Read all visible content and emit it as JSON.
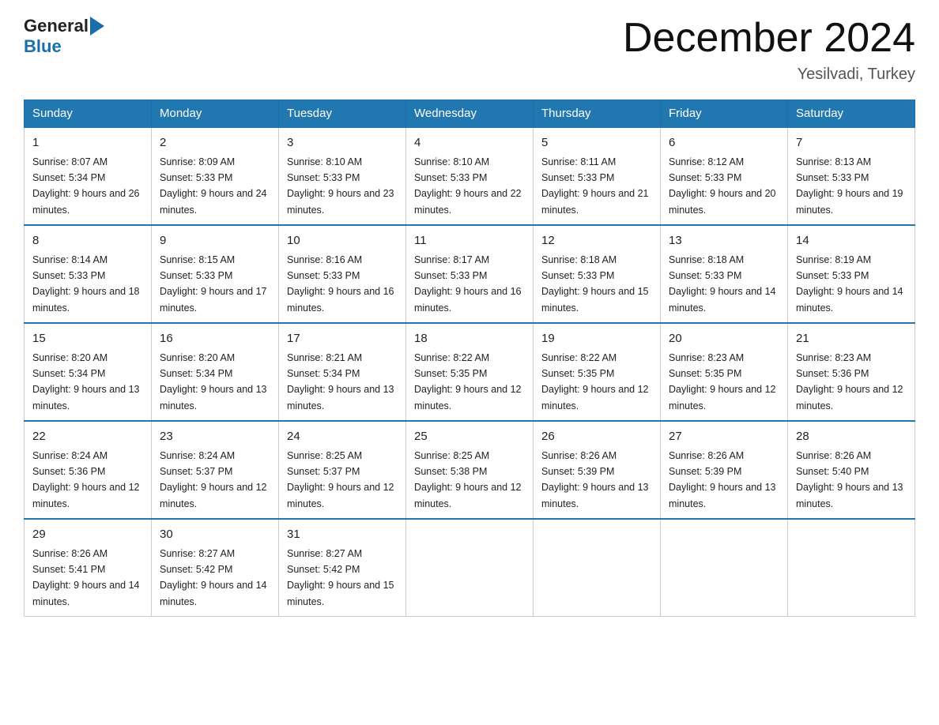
{
  "logo": {
    "general": "General",
    "blue": "Blue"
  },
  "title": "December 2024",
  "location": "Yesilvadi, Turkey",
  "days_of_week": [
    "Sunday",
    "Monday",
    "Tuesday",
    "Wednesday",
    "Thursday",
    "Friday",
    "Saturday"
  ],
  "weeks": [
    [
      {
        "num": "1",
        "sunrise": "8:07 AM",
        "sunset": "5:34 PM",
        "daylight": "9 hours and 26 minutes."
      },
      {
        "num": "2",
        "sunrise": "8:09 AM",
        "sunset": "5:33 PM",
        "daylight": "9 hours and 24 minutes."
      },
      {
        "num": "3",
        "sunrise": "8:10 AM",
        "sunset": "5:33 PM",
        "daylight": "9 hours and 23 minutes."
      },
      {
        "num": "4",
        "sunrise": "8:10 AM",
        "sunset": "5:33 PM",
        "daylight": "9 hours and 22 minutes."
      },
      {
        "num": "5",
        "sunrise": "8:11 AM",
        "sunset": "5:33 PM",
        "daylight": "9 hours and 21 minutes."
      },
      {
        "num": "6",
        "sunrise": "8:12 AM",
        "sunset": "5:33 PM",
        "daylight": "9 hours and 20 minutes."
      },
      {
        "num": "7",
        "sunrise": "8:13 AM",
        "sunset": "5:33 PM",
        "daylight": "9 hours and 19 minutes."
      }
    ],
    [
      {
        "num": "8",
        "sunrise": "8:14 AM",
        "sunset": "5:33 PM",
        "daylight": "9 hours and 18 minutes."
      },
      {
        "num": "9",
        "sunrise": "8:15 AM",
        "sunset": "5:33 PM",
        "daylight": "9 hours and 17 minutes."
      },
      {
        "num": "10",
        "sunrise": "8:16 AM",
        "sunset": "5:33 PM",
        "daylight": "9 hours and 16 minutes."
      },
      {
        "num": "11",
        "sunrise": "8:17 AM",
        "sunset": "5:33 PM",
        "daylight": "9 hours and 16 minutes."
      },
      {
        "num": "12",
        "sunrise": "8:18 AM",
        "sunset": "5:33 PM",
        "daylight": "9 hours and 15 minutes."
      },
      {
        "num": "13",
        "sunrise": "8:18 AM",
        "sunset": "5:33 PM",
        "daylight": "9 hours and 14 minutes."
      },
      {
        "num": "14",
        "sunrise": "8:19 AM",
        "sunset": "5:33 PM",
        "daylight": "9 hours and 14 minutes."
      }
    ],
    [
      {
        "num": "15",
        "sunrise": "8:20 AM",
        "sunset": "5:34 PM",
        "daylight": "9 hours and 13 minutes."
      },
      {
        "num": "16",
        "sunrise": "8:20 AM",
        "sunset": "5:34 PM",
        "daylight": "9 hours and 13 minutes."
      },
      {
        "num": "17",
        "sunrise": "8:21 AM",
        "sunset": "5:34 PM",
        "daylight": "9 hours and 13 minutes."
      },
      {
        "num": "18",
        "sunrise": "8:22 AM",
        "sunset": "5:35 PM",
        "daylight": "9 hours and 12 minutes."
      },
      {
        "num": "19",
        "sunrise": "8:22 AM",
        "sunset": "5:35 PM",
        "daylight": "9 hours and 12 minutes."
      },
      {
        "num": "20",
        "sunrise": "8:23 AM",
        "sunset": "5:35 PM",
        "daylight": "9 hours and 12 minutes."
      },
      {
        "num": "21",
        "sunrise": "8:23 AM",
        "sunset": "5:36 PM",
        "daylight": "9 hours and 12 minutes."
      }
    ],
    [
      {
        "num": "22",
        "sunrise": "8:24 AM",
        "sunset": "5:36 PM",
        "daylight": "9 hours and 12 minutes."
      },
      {
        "num": "23",
        "sunrise": "8:24 AM",
        "sunset": "5:37 PM",
        "daylight": "9 hours and 12 minutes."
      },
      {
        "num": "24",
        "sunrise": "8:25 AM",
        "sunset": "5:37 PM",
        "daylight": "9 hours and 12 minutes."
      },
      {
        "num": "25",
        "sunrise": "8:25 AM",
        "sunset": "5:38 PM",
        "daylight": "9 hours and 12 minutes."
      },
      {
        "num": "26",
        "sunrise": "8:26 AM",
        "sunset": "5:39 PM",
        "daylight": "9 hours and 13 minutes."
      },
      {
        "num": "27",
        "sunrise": "8:26 AM",
        "sunset": "5:39 PM",
        "daylight": "9 hours and 13 minutes."
      },
      {
        "num": "28",
        "sunrise": "8:26 AM",
        "sunset": "5:40 PM",
        "daylight": "9 hours and 13 minutes."
      }
    ],
    [
      {
        "num": "29",
        "sunrise": "8:26 AM",
        "sunset": "5:41 PM",
        "daylight": "9 hours and 14 minutes."
      },
      {
        "num": "30",
        "sunrise": "8:27 AM",
        "sunset": "5:42 PM",
        "daylight": "9 hours and 14 minutes."
      },
      {
        "num": "31",
        "sunrise": "8:27 AM",
        "sunset": "5:42 PM",
        "daylight": "9 hours and 15 minutes."
      },
      null,
      null,
      null,
      null
    ]
  ]
}
